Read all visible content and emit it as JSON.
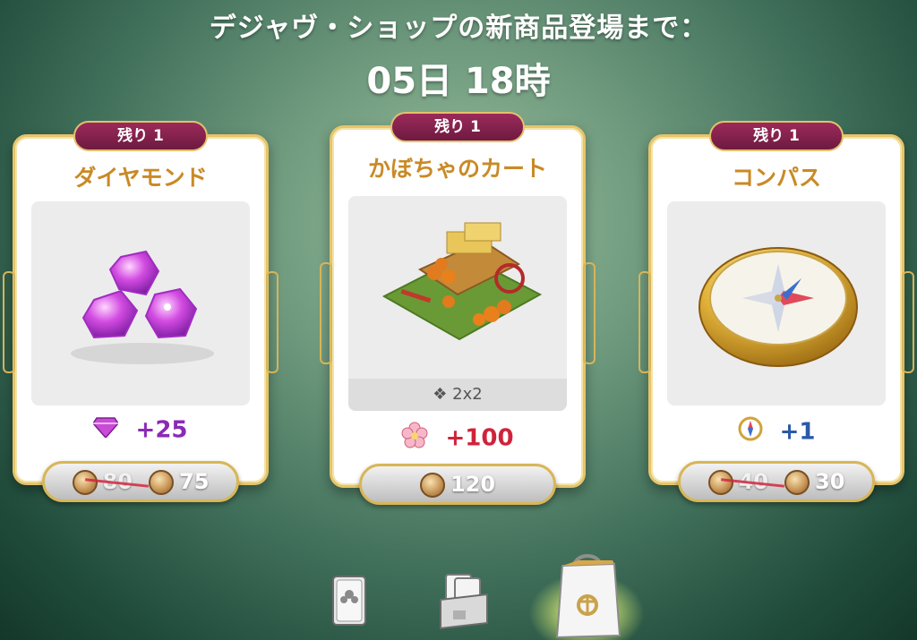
{
  "header": {
    "countdown_label": "デジャヴ・ショップの新商品登場まで：",
    "countdown_value": "05日 18時"
  },
  "items": [
    {
      "stock": "残り 1",
      "name": "ダイヤモンド",
      "reward_icon": "diamond-icon",
      "reward": "+25",
      "reward_color": "#8a2bb5",
      "old_price": "80",
      "price": "75"
    },
    {
      "stock": "残り 1",
      "name": "かぼちゃのカート",
      "size": "2x2",
      "reward_icon": "flower-icon",
      "reward": "+100",
      "reward_color": "#d0233a",
      "price": "120"
    },
    {
      "stock": "残り 1",
      "name": "コンパス",
      "reward_icon": "compass-icon",
      "reward": "+1",
      "reward_color": "#2a5aa8",
      "old_price": "40",
      "price": "30"
    }
  ],
  "nav": {
    "tabs": [
      "card-tab-icon",
      "card-box-tab-icon",
      "shop-bag-tab-icon"
    ],
    "active": "shop-bag-tab-icon"
  },
  "colors": {
    "badge": "#7d1f4b",
    "title": "#c98a25",
    "frame_gold": "#e6c46a"
  }
}
